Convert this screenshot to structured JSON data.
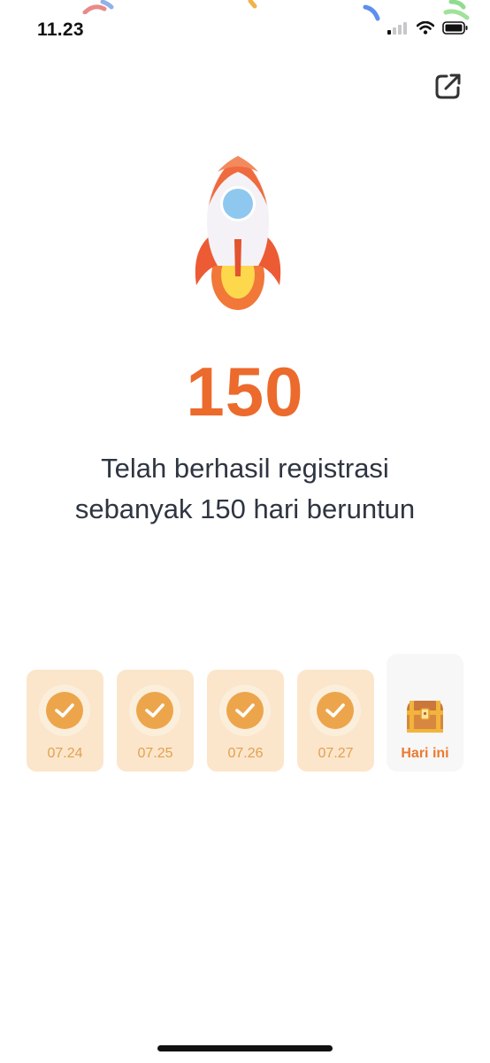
{
  "status_bar": {
    "time": "11.23"
  },
  "header": {
    "share_icon": "external-share-icon"
  },
  "streak": {
    "count": "150",
    "message_line1": "Telah berhasil registrasi",
    "message_line2": "sebanyak 150 hari beruntun"
  },
  "days": [
    {
      "date": "07.24",
      "checked": true
    },
    {
      "date": "07.25",
      "checked": true
    },
    {
      "date": "07.26",
      "checked": true
    },
    {
      "date": "07.27",
      "checked": true
    }
  ],
  "today": {
    "label": "Hari ini",
    "icon": "treasure-chest-icon"
  },
  "colors": {
    "accent": "#ec6a2c",
    "card_bg": "#fbe6cc",
    "check": "#eda54c",
    "date_text": "#e2a14f"
  }
}
